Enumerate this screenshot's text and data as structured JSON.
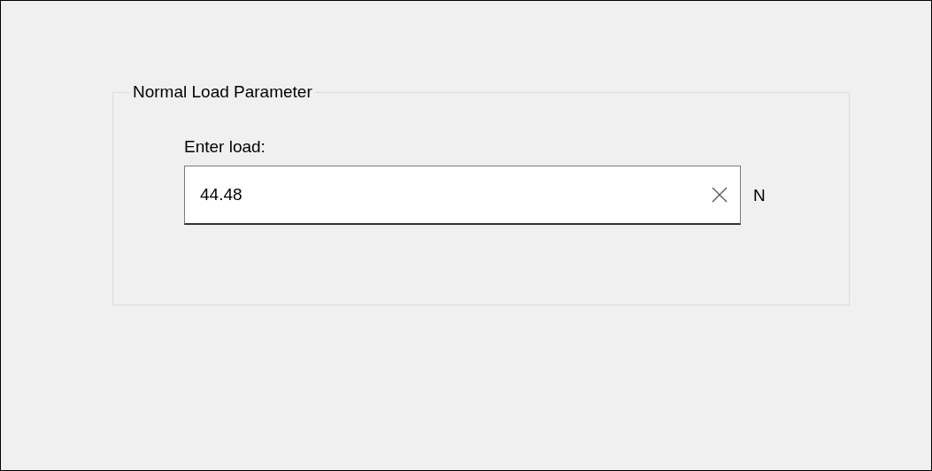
{
  "group": {
    "title": "Normal Load Parameter"
  },
  "load_field": {
    "label": "Enter load:",
    "value": "44.48",
    "unit": "N"
  }
}
